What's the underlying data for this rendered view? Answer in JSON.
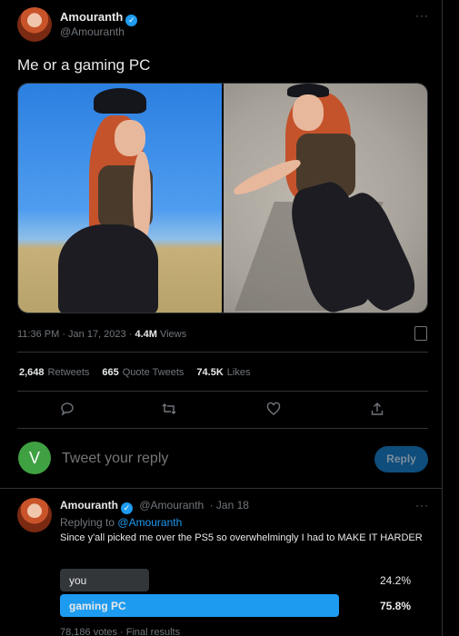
{
  "tweet": {
    "author_name": "Amouranth",
    "author_handle": "@Amouranth",
    "more_icon": "more-dots-icon",
    "text": "Me or a gaming PC",
    "timestamp": "11:36 PM · Jan 17, 2023 ·",
    "views_count": "4.4M",
    "views_label": "Views",
    "stats": {
      "retweets_count": "2,648",
      "retweets_label": "Retweets",
      "quotes_count": "665",
      "quotes_label": "Quote Tweets",
      "likes_count": "74.5K",
      "likes_label": "Likes"
    },
    "actions": [
      "reply-icon",
      "retweet-icon",
      "like-icon",
      "share-icon"
    ]
  },
  "composer": {
    "avatar_letter": "V",
    "avatar_color": "#3fa142",
    "placeholder": "Tweet your reply",
    "button_label": "Reply"
  },
  "reply": {
    "author_name": "Amouranth",
    "author_handle": "@Amouranth",
    "date": "· Jan 18",
    "replying_prefix": "Replying to",
    "replying_handle": "@Amouranth",
    "text": "Since y'all picked me over the PS5 so overwhelmingly I had to MAKE IT HARDER",
    "poll": {
      "options": [
        {
          "label": "you",
          "percent_text": "24.2%",
          "fraction": 0.242
        },
        {
          "label": "gaming PC",
          "percent_text": "75.8%",
          "fraction": 0.758
        }
      ],
      "footer": "78,186 votes · Final results"
    }
  },
  "colors": {
    "background": "#000000",
    "accent": "#1d9bf0",
    "muted": "#71767b",
    "poll_winner": "#1d9bf0",
    "poll_loser": "#333639"
  }
}
